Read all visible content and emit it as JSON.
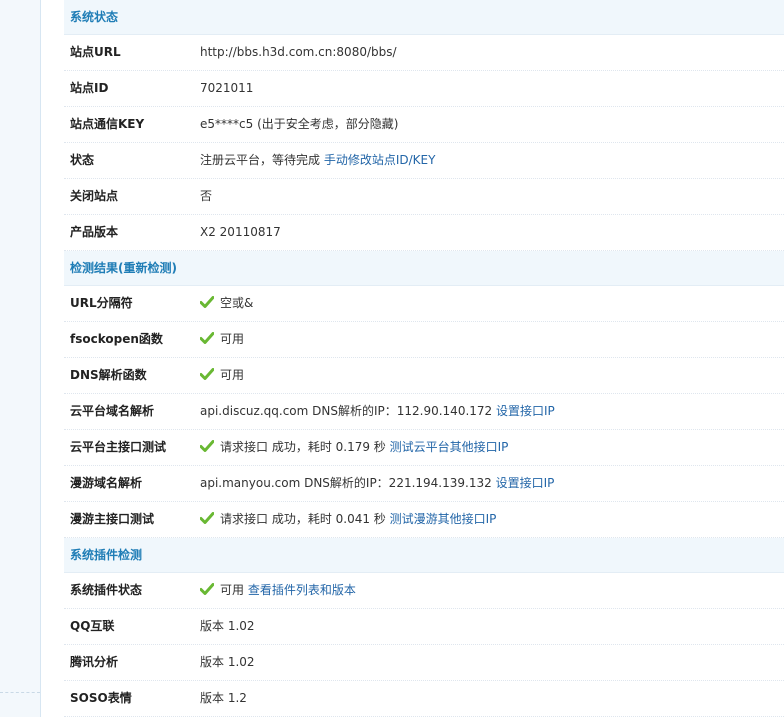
{
  "colors": {
    "section_bg": "#f0f7fc",
    "section_title": "#1f7db6",
    "link": "#2366a8",
    "check": "#69b833"
  },
  "sections": [
    {
      "title": "系统状态",
      "rows": [
        {
          "label": "站点URL",
          "value": "http://bbs.h3d.com.cn:8080/bbs/"
        },
        {
          "label": "站点ID",
          "value": "7021011"
        },
        {
          "label": "站点通信KEY",
          "value": "e5****c5 (出于安全考虑，部分隐藏)"
        },
        {
          "label": "状态",
          "value": "注册云平台，等待完成",
          "link": "手动修改站点ID/KEY"
        },
        {
          "label": "关闭站点",
          "value": "否"
        },
        {
          "label": "产品版本",
          "value": "X2 20110817"
        }
      ]
    },
    {
      "title": "检测结果",
      "title_paren_open": "(",
      "title_link": "重新检测",
      "title_paren_close": ")",
      "rows": [
        {
          "label": "URL分隔符",
          "check": true,
          "value": "空或&"
        },
        {
          "label": "fsockopen函数",
          "check": true,
          "value": "可用"
        },
        {
          "label": "DNS解析函数",
          "check": true,
          "value": "可用"
        },
        {
          "label": "云平台域名解析",
          "value": "api.discuz.qq.com DNS解析的IP：112.90.140.172",
          "link": "设置接口IP"
        },
        {
          "label": "云平台主接口测试",
          "check": true,
          "value": "请求接口 成功，耗时 0.179 秒",
          "link": "测试云平台其他接口IP"
        },
        {
          "label": "漫游域名解析",
          "value": "api.manyou.com DNS解析的IP：221.194.139.132",
          "link": "设置接口IP"
        },
        {
          "label": "漫游主接口测试",
          "check": true,
          "value": "请求接口 成功，耗时 0.041 秒",
          "link": "测试漫游其他接口IP"
        }
      ]
    },
    {
      "title": "系统插件检测",
      "rows": [
        {
          "label": "系统插件状态",
          "check": true,
          "value": "可用",
          "link": "查看插件列表和版本"
        },
        {
          "label": "QQ互联",
          "value": "版本 1.02"
        },
        {
          "label": "腾讯分析",
          "value": "版本 1.02"
        },
        {
          "label": "SOSO表情",
          "value": "版本 1.2"
        }
      ]
    }
  ]
}
